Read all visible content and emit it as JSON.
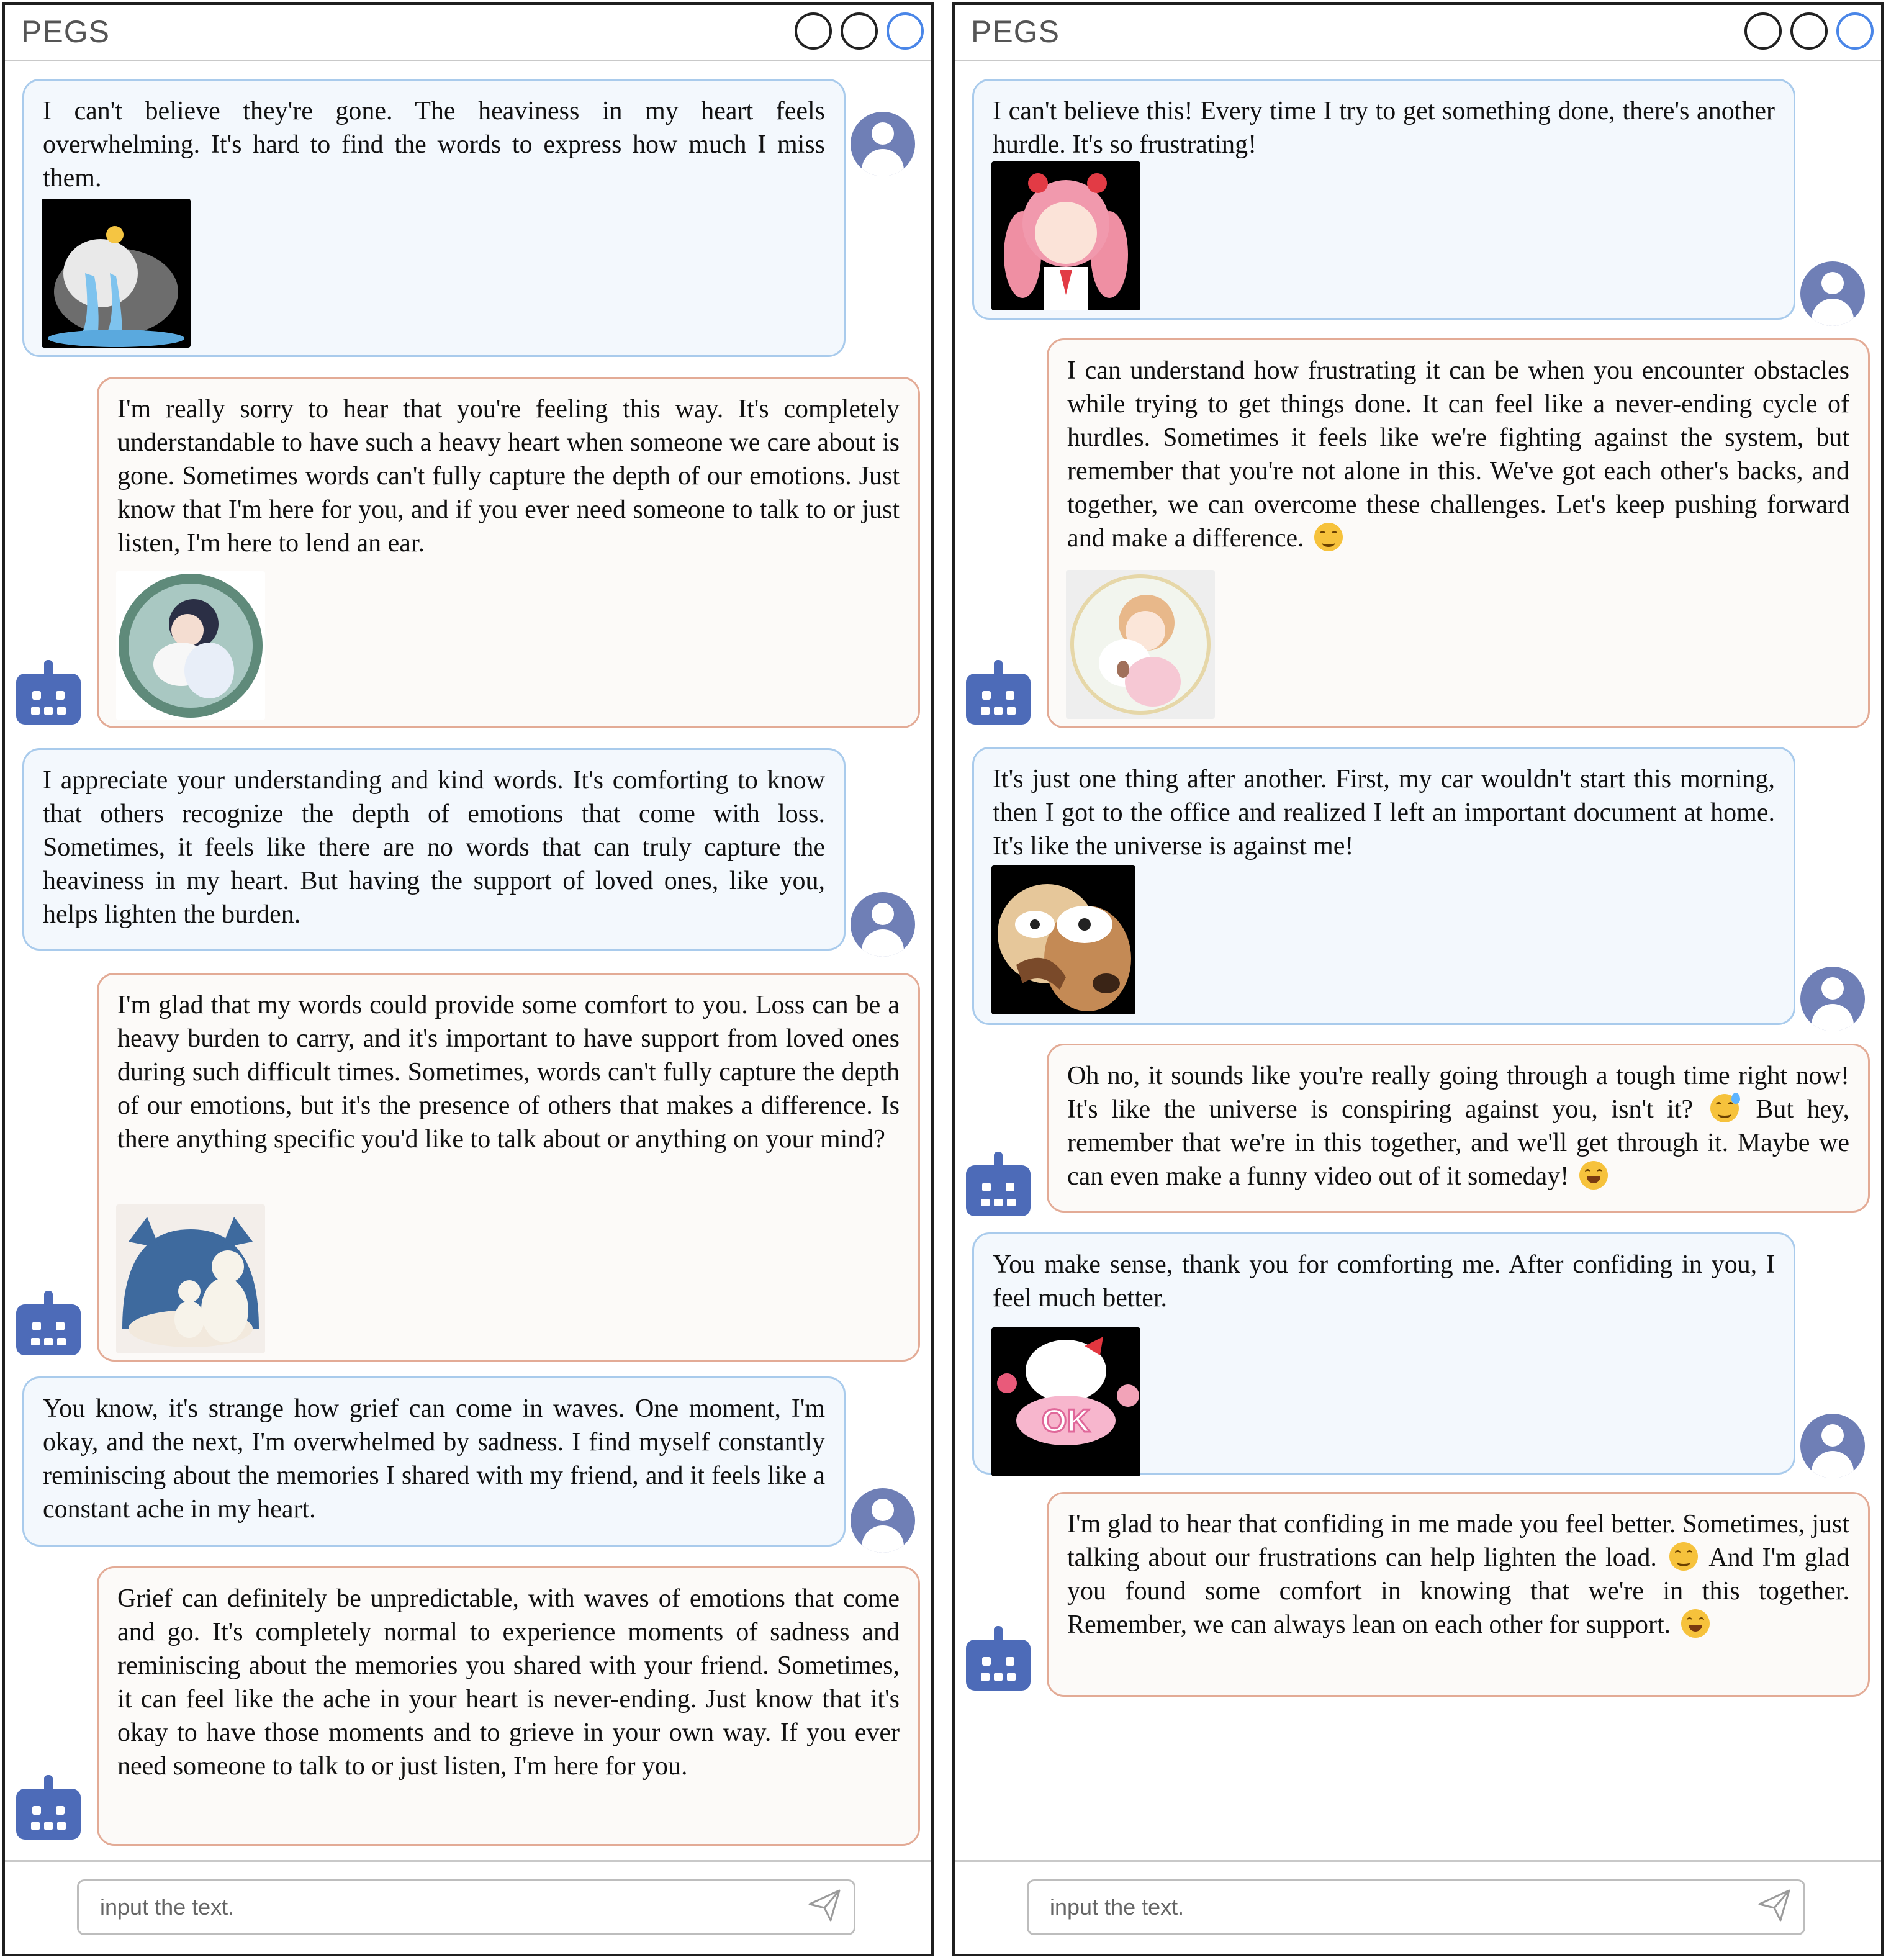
{
  "app_title": "PEGS",
  "input_placeholder": "input the text.",
  "left": {
    "messages": [
      {
        "role": "user",
        "text": "I can't believe they're gone. The heaviness in my heart feels overwhelming. It's hard to find the words to express how much I miss them.",
        "sticker": "sad-penguin-sticker"
      },
      {
        "role": "bot",
        "text": "I'm really sorry to hear that you're feeling this way. It's completely understandable to have such a heavy heart when someone we care about is gone. Sometimes words can't fully capture the depth of our emotions. Just know that I'm here for you, and if you ever need someone to talk to or just listen, I'm here to lend an ear.",
        "sticker": "girl-hugging-pet-sticker"
      },
      {
        "role": "user",
        "text": "I appreciate your understanding and kind words. It's comforting to know that others recognize the depth of emotions that come with loss. Sometimes, it feels like there are no words that can truly capture the heaviness in my heart. But having the support of loved ones, like you, helps lighten the burden."
      },
      {
        "role": "bot",
        "text": "I'm glad that my words could provide some comfort to you. Loss can be a heavy burden to carry, and it's important to have support from loved ones during such difficult times. Sometimes, words can't fully capture the depth of our emotions, but it's the presence of others that makes a difference. Is there anything specific you'd like to talk about or anything on your mind?",
        "sticker": "polar-bears-sticker"
      },
      {
        "role": "user",
        "text": "You know, it's strange how grief can come in waves. One moment, I'm okay, and the next, I'm overwhelmed by sadness. I find myself constantly reminiscing about the memories I shared with my friend, and it feels like a constant ache in my heart."
      },
      {
        "role": "bot",
        "text": "Grief can definitely be unpredictable, with waves of emotions that come and go. It's completely normal to experience moments of sadness and reminiscing about the memories you shared with your friend. Sometimes, it can feel like the ache in your heart is never-ending. Just know that it's okay to have those moments and to grieve in your own way. If you ever need someone to talk to or just listen, I'm here for you."
      }
    ]
  },
  "right": {
    "messages": [
      {
        "role": "user",
        "text": "I can't believe this! Every time I try to get something done, there's another hurdle. It's so frustrating!",
        "sticker": "angry-anime-girl-sticker"
      },
      {
        "role": "bot",
        "text": "I can understand how frustrating it can be when you encounter obstacles while trying to get things done. It can feel like a never-ending cycle of hurdles. Sometimes it feels like we're fighting against the system, but remember that you're not alone in this. We've got each other's backs, and together, we can overcome these challenges. Let's keep pushing forward and make a difference.",
        "emoji": "smiling-face-emoji",
        "sticker": "anime-girl-hugging-pet-sticker"
      },
      {
        "role": "user",
        "text": "It's just one thing after another. First, my car wouldn't start this morning, then I got to the office and realized I left an important document at home. It's like the universe is against me!",
        "sticker": "angry-old-man-dog-sticker"
      },
      {
        "role": "bot",
        "text1": "Oh no, it sounds like you're really going through a tough time right now! It's like the universe is conspiring against you, isn't it?",
        "text2": "But hey, remember that we're in this together, and we'll get through it. Maybe we can even make a funny video out of it someday!",
        "emoji1": "grinning-sweat-emoji",
        "emoji2": "grinning-emoji"
      },
      {
        "role": "user",
        "text": "You make sense, thank you for comforting me. After confiding in you, I feel much better.",
        "sticker": "hello-kitty-ok-sticker",
        "sticker_text": "OK"
      },
      {
        "role": "bot",
        "text1": "I'm glad to hear that confiding in me made you feel better. Sometimes, just talking about our frustrations can help lighten the load.",
        "text2": "And I'm glad you found some comfort in knowing that we're in this together. Remember, we can always lean on each other for support.",
        "emoji1": "smiling-face-emoji",
        "emoji2": "grinning-emoji"
      }
    ]
  }
}
